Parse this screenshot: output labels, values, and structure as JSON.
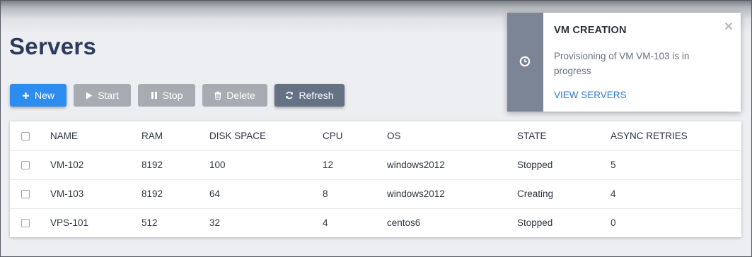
{
  "page": {
    "title": "Servers"
  },
  "toolbar": {
    "new_label": "New",
    "start_label": "Start",
    "stop_label": "Stop",
    "delete_label": "Delete",
    "refresh_label": "Refresh"
  },
  "table": {
    "headers": [
      "NAME",
      "RAM",
      "DISK SPACE",
      "CPU",
      "OS",
      "STATE",
      "ASYNC RETRIES"
    ],
    "rows": [
      [
        "VM-102",
        "8192",
        "100",
        "12",
        "windows2012",
        "Stopped",
        "5"
      ],
      [
        "VM-103",
        "8192",
        "64",
        "8",
        "windows2012",
        "Creating",
        "4"
      ],
      [
        "VPS-101",
        "512",
        "32",
        "4",
        "centos6",
        "Stopped",
        "0"
      ]
    ]
  },
  "notification": {
    "title": "VM CREATION",
    "message": "Provisioning of VM VM-103 is in progress",
    "link_label": "VIEW SERVERS",
    "icon": "clock-icon"
  },
  "colors": {
    "primary": "#2d8cf0",
    "disabled": "#a8abb1",
    "secondary": "#657284",
    "title": "#2c3a5c",
    "link": "#2f79d4"
  }
}
